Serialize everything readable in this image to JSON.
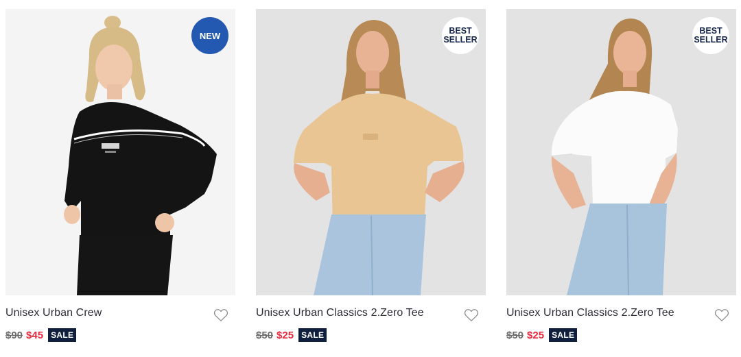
{
  "colors": {
    "new_badge": "#2459b1",
    "best_badge_text": "#16254a",
    "sale_price": "#e8283c",
    "sale_tag_bg": "#0f1f3d"
  },
  "products": [
    {
      "name": "Unisex Urban Crew",
      "badge": [
        "NEW"
      ],
      "badge_type": "new",
      "was_price": "$90",
      "now_price": "$45",
      "sale_label": "SALE",
      "image_desc": "woman in black long-sleeve crew top and black pants",
      "wishlist_icon": "heart-outline-icon"
    },
    {
      "name": "Unisex Urban Classics 2.Zero Tee",
      "badge": [
        "BEST",
        "SELLER"
      ],
      "badge_type": "best",
      "was_price": "$50",
      "now_price": "$25",
      "sale_label": "SALE",
      "image_desc": "woman in tan oversized tee and light blue jeans",
      "wishlist_icon": "heart-outline-icon"
    },
    {
      "name": "Unisex Urban Classics 2.Zero Tee",
      "badge": [
        "BEST",
        "SELLER"
      ],
      "badge_type": "best",
      "was_price": "$50",
      "now_price": "$25",
      "sale_label": "SALE",
      "image_desc": "woman in white oversized tee and light blue jeans",
      "wishlist_icon": "heart-outline-icon"
    }
  ]
}
